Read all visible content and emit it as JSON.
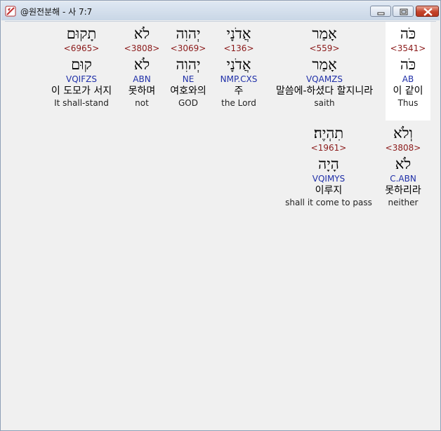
{
  "window": {
    "title": "@원전분해 - 사 7:7",
    "accent_color": "#c4432b"
  },
  "verse_lines": [
    [
      {
        "hebrew": "כֹּה",
        "strong": "<3541>",
        "lemma": "כֹּה",
        "code": "AB",
        "korean": "이 같이",
        "english": "Thus"
      },
      {
        "hebrew": "אָמַר",
        "strong": "<559>",
        "lemma": "אָמַר",
        "code": "VQAMZS",
        "korean": "말씀에-하셨다 할지니라",
        "english": "saith"
      },
      {
        "hebrew": "אֲדֹנָי",
        "strong": "<136>",
        "lemma": "אֲדֹנָי",
        "code": "NMP.CXS",
        "korean": "주",
        "english": "the Lord"
      },
      {
        "hebrew": "יְהוִה",
        "strong": "<3069>",
        "lemma": "יְהוִה",
        "code": "NE",
        "korean": "여호와의",
        "english": "GOD"
      },
      {
        "hebrew": "לֹא",
        "strong": "<3808>",
        "lemma": "לֹא",
        "code": "ABN",
        "korean": "못하며",
        "english": "not"
      },
      {
        "hebrew": "תָקוּם",
        "strong": "<6965>",
        "lemma": "קוּם",
        "code": "VQIFZS",
        "korean": "이 도모가 서지",
        "english": "It shall-stand"
      }
    ],
    [
      {
        "hebrew": "וְלֹא",
        "strong": "<3808>",
        "lemma": "לֹא",
        "code": "C.ABN",
        "korean": "못하리라",
        "english": "neither"
      },
      {
        "hebrew": "תִהְיֶה׃",
        "strong": "<1961>",
        "lemma": "הָיָה",
        "code": "VQIMYS",
        "korean": "이루지",
        "english": "shall it come to pass"
      }
    ]
  ]
}
